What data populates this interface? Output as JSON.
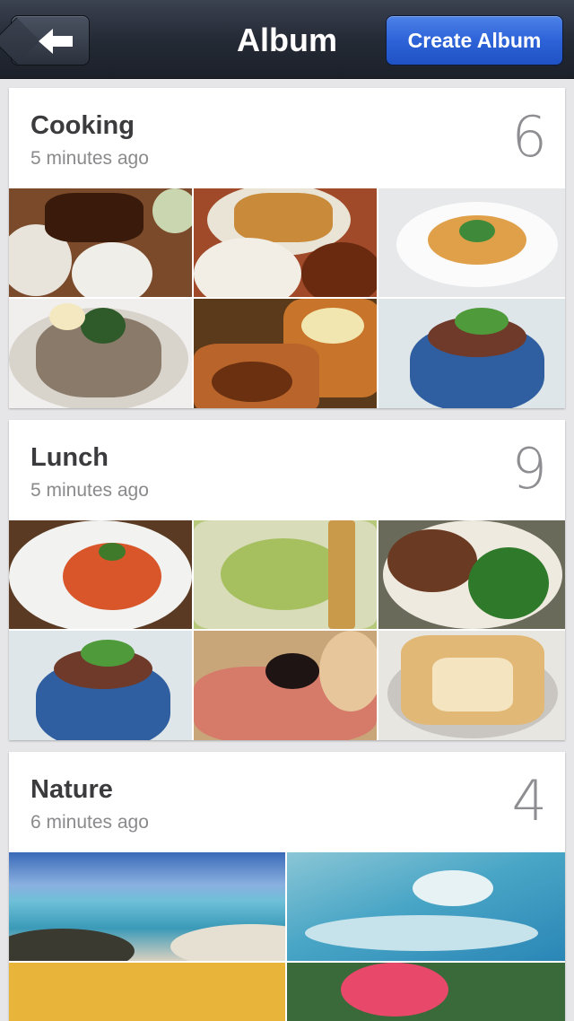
{
  "navbar": {
    "title": "Album",
    "back_icon": "back-arrow-icon",
    "create_button_label": "Create Album"
  },
  "albums": [
    {
      "name": "Cooking",
      "time": "5 minutes ago",
      "count": "6"
    },
    {
      "name": "Lunch",
      "time": "5 minutes ago",
      "count": "9"
    },
    {
      "name": "Nature",
      "time": "6 minutes ago",
      "count": "4"
    }
  ],
  "colors": {
    "navbar_bg": "#252b36",
    "create_button_bg": "#2d63d8",
    "page_bg": "#e6e6e8"
  }
}
